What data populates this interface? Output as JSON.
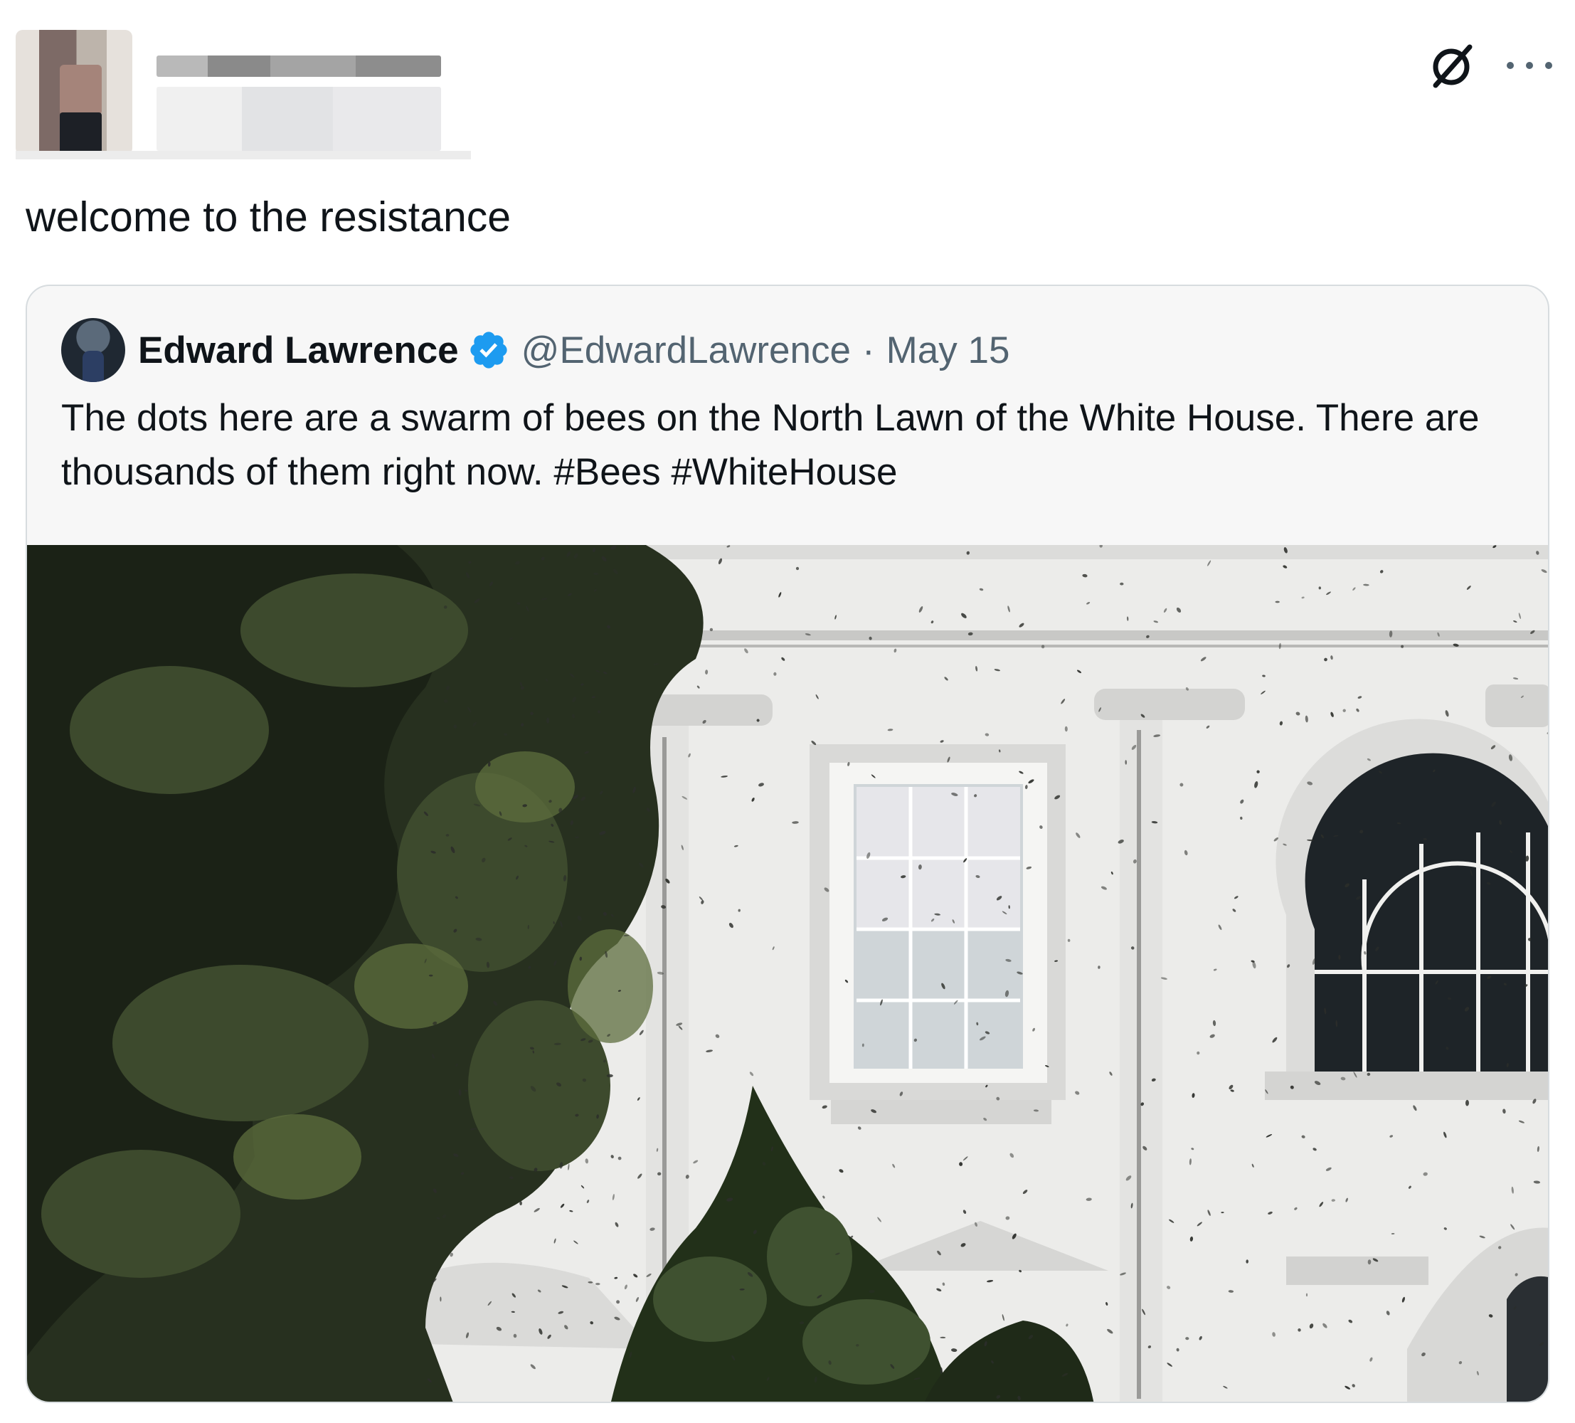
{
  "post": {
    "text": "welcome to the resistance"
  },
  "icons": {
    "grok": "grok-icon",
    "more": "more-icon",
    "verified": "verified-badge-icon"
  },
  "quote": {
    "author_name": "Edward Lawrence",
    "handle": "@EdwardLawrence",
    "separator": "·",
    "date": "May 15",
    "text": "The dots here are a swarm of bees on the North Lawn of the White House. There are thousands of them right now. #Bees #WhiteHouse"
  },
  "colors": {
    "text": "#0f1419",
    "muted": "#536471",
    "verified": "#1d9bf0",
    "card_border": "#d7dcdf"
  }
}
